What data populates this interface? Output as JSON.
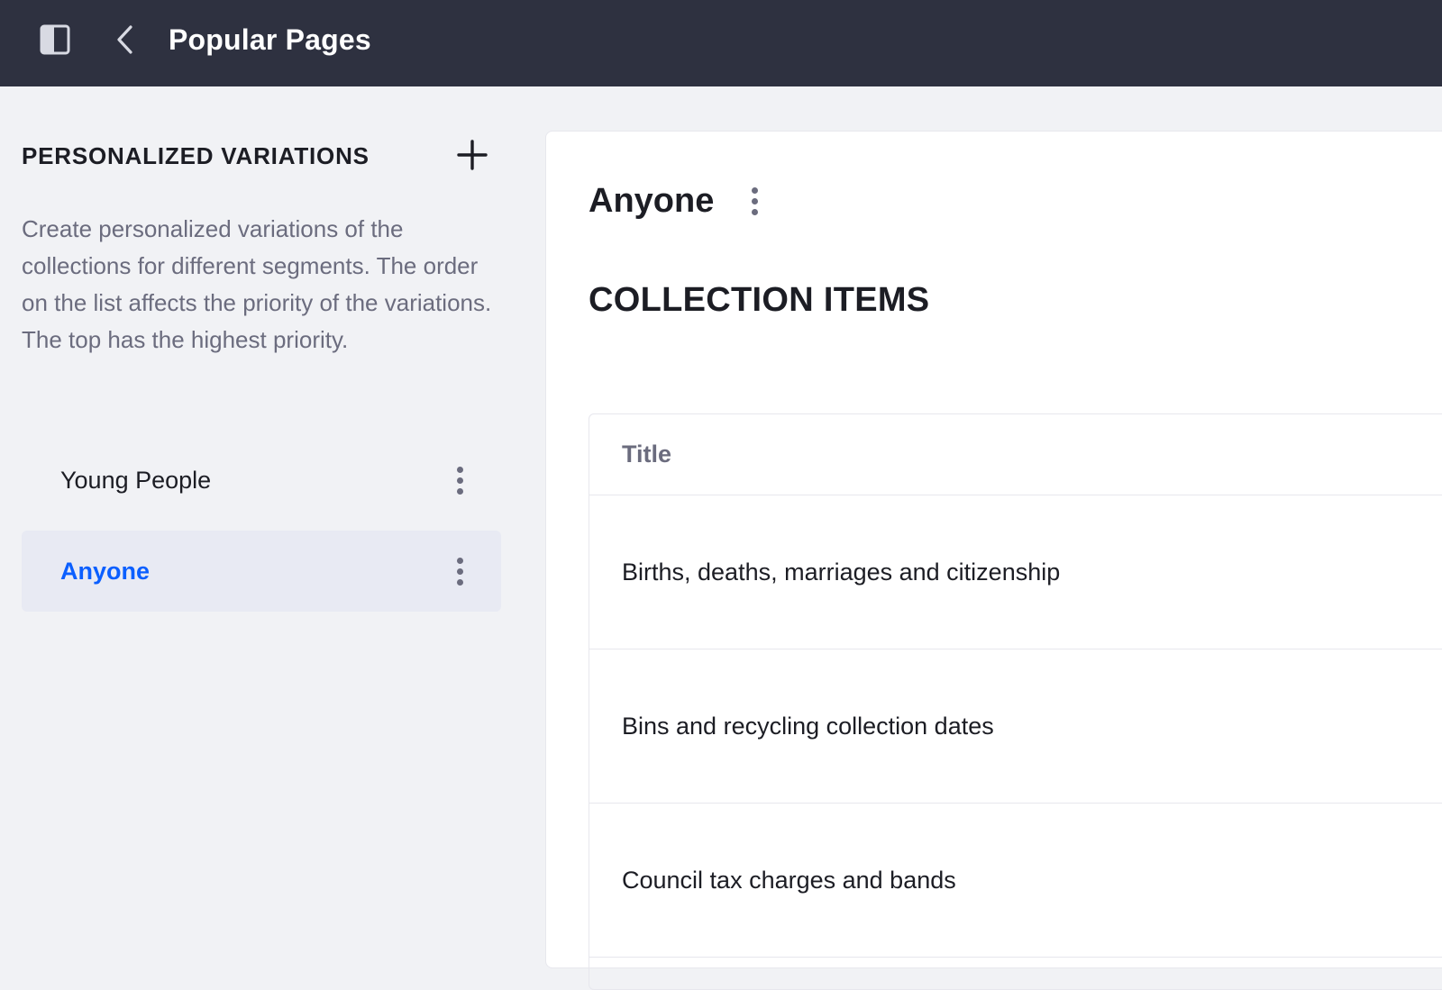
{
  "topbar": {
    "title": "Popular Pages",
    "sidebar_toggle_icon": "sidebar-panel-icon",
    "back_icon": "chevron-left-icon",
    "background": "#2e3140"
  },
  "sidebar": {
    "heading": "PERSONALIZED VARIATIONS",
    "add_icon": "plus-icon",
    "description": "Create personalized variations of the collections for different segments. The order on the list affects the priority of the variations. The top has the highest priority.",
    "items": [
      {
        "label": "Young People",
        "active": false
      },
      {
        "label": "Anyone",
        "active": true
      }
    ]
  },
  "main": {
    "variation_title": "Anyone",
    "collection_heading": "COLLECTION ITEMS",
    "table": {
      "column_title": "Title",
      "rows": [
        "Births, deaths, marriages and citizenship",
        "Bins and recycling collection dates",
        "Council tax charges and bands"
      ]
    }
  },
  "colors": {
    "accent": "#0b5fff",
    "text_primary": "#1c1d24",
    "text_secondary": "#6b6c7e",
    "panel_bg": "#f1f2f5",
    "active_item_bg": "#e8eaf3"
  }
}
